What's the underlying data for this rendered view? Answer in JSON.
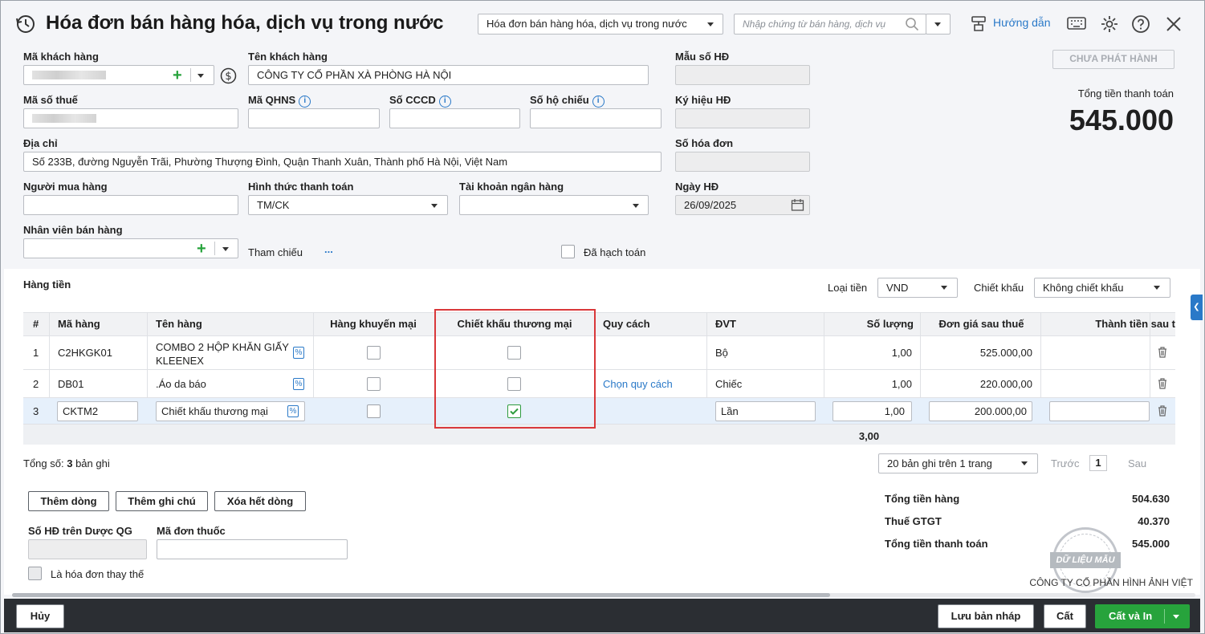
{
  "header": {
    "title": "Hóa đơn bán hàng hóa, dịch vụ trong nước",
    "type_select": "Hóa đơn bán hàng hóa, dịch vụ trong nước",
    "search_placeholder": "Nhập chứng từ bán hàng, dịch vụ",
    "guide": "Hướng dẫn"
  },
  "form": {
    "customer_code_label": "Mã khách hàng",
    "customer_name_label": "Tên khách hàng",
    "customer_name": "CÔNG TY CỔ PHẦN XÀ PHÒNG HÀ NỘI",
    "tax_code_label": "Mã số thuế",
    "qhns_label": "Mã QHNS",
    "cccd_label": "Số CCCD",
    "passport_label": "Số hộ chiếu",
    "address_label": "Địa chỉ",
    "address": "Số 233B, đường Nguyễn Trãi, Phường Thượng Đình, Quận Thanh Xuân, Thành phố Hà Nội, Việt Nam",
    "buyer_label": "Người mua hàng",
    "payment_label": "Hình thức thanh toán",
    "payment_value": "TM/CK",
    "bank_label": "Tài khoản ngân hàng",
    "staff_label": "Nhân viên bán hàng",
    "reference_label": "Tham chiếu",
    "reference_more": "...",
    "posted_label": "Đã hạch toán"
  },
  "invoice": {
    "template_label": "Mẫu số HĐ",
    "symbol_label": "Ký hiệu HĐ",
    "number_label": "Số hóa đơn",
    "date_label": "Ngày HĐ",
    "date_value": "26/09/2025",
    "status_badge": "CHƯA PHÁT HÀNH",
    "total_label": "Tổng tiền thanh toán",
    "total_value": "545.000"
  },
  "goods": {
    "section_title": "Hàng tiền",
    "currency_label": "Loại tiền",
    "currency_value": "VND",
    "discount_label": "Chiết khấu",
    "discount_value": "Không chiết khấu",
    "columns": [
      "#",
      "Mã hàng",
      "Tên hàng",
      "Hàng khuyến mại",
      "Chiết khấu thương mại",
      "Quy cách",
      "ĐVT",
      "Số lượng",
      "Đơn giá sau thuế",
      "Thành tiền sau t"
    ],
    "rows": [
      {
        "no": "1",
        "code": "C2HKGK01",
        "name": "COMBO 2 HỘP KHĂN GIẤY KLEENEX",
        "spec": "",
        "unit": "Bộ",
        "qty": "1,00",
        "price": "525.000,00",
        "promo": false,
        "trade_discount": false
      },
      {
        "no": "2",
        "code": "DB01",
        "name": ".Áo da báo",
        "spec": "Chọn quy cách",
        "unit": "Chiếc",
        "qty": "1,00",
        "price": "220.000,00",
        "promo": false,
        "trade_discount": false
      },
      {
        "no": "3",
        "code": "CKTM2",
        "name": "Chiết khấu thương mại",
        "spec": "",
        "unit": "Lần",
        "qty": "1,00",
        "price": "200.000,00",
        "promo": false,
        "trade_discount": true
      }
    ],
    "qty_total": "3,00",
    "record_count_prefix": "Tổng số:",
    "record_count": "3",
    "record_count_suffix": "bản ghi",
    "page_size": "20 bản ghi trên 1 trang",
    "prev": "Trước",
    "page": "1",
    "next": "Sau"
  },
  "actions": {
    "add_row": "Thêm dòng",
    "add_note": "Thêm ghi chú",
    "delete_all": "Xóa hết dòng"
  },
  "extra": {
    "duoc_label": "Số HĐ trên Dược QG",
    "prescription_label": "Mã đơn thuốc",
    "replace_label": "Là hóa đơn thay thế"
  },
  "summary": {
    "goods_total_label": "Tổng tiền hàng",
    "goods_total": "504.630",
    "vat_label": "Thuế GTGT",
    "vat": "40.370",
    "pay_total_label": "Tổng tiền thanh toán",
    "pay_total": "545.000",
    "stamp_text": "DỮ LIỆU MẪU",
    "company": "CÔNG TY CỔ PHẦN HÌNH ẢNH VIỆT"
  },
  "footer": {
    "cancel": "Hủy",
    "save_draft": "Lưu bản nháp",
    "save": "Cất",
    "save_print": "Cất và In"
  },
  "colors": {
    "accent": "#2a79c8",
    "primary_green": "#27a33c",
    "footer_bg": "#2b2e33",
    "highlight": "#d9383a"
  }
}
